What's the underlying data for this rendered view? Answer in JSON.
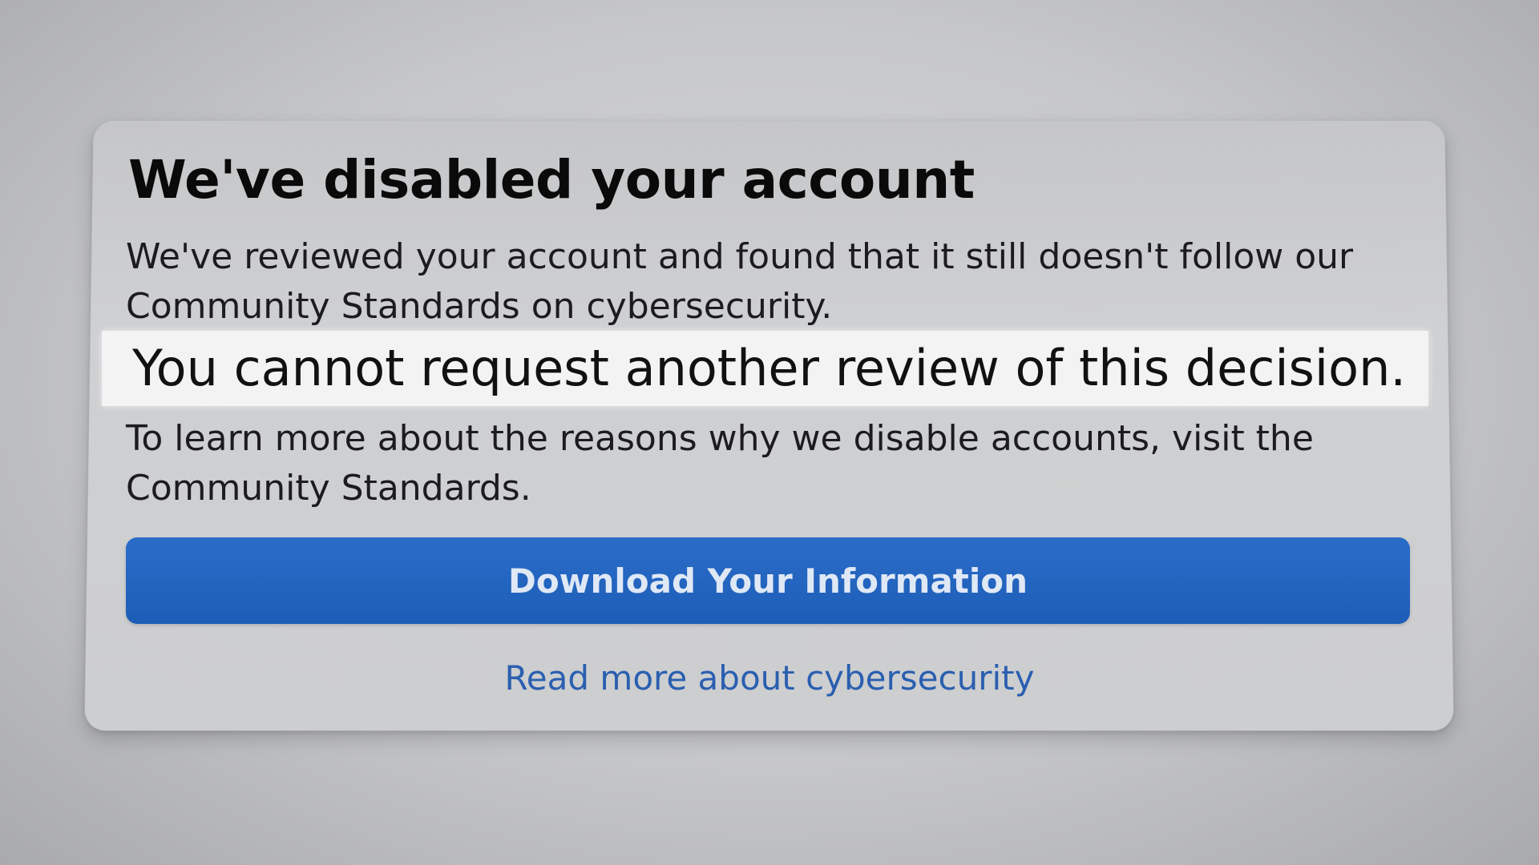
{
  "dialog": {
    "title": "We've disabled your account",
    "body_line_1": "We've reviewed your account and found that it still doesn't follow our Community Standards on cybersecurity.",
    "highlight": "You cannot request another review of this decision.",
    "body_line_2": "To learn more about the reasons why we disable accounts, visit the Community Standards.",
    "primary_button_label": "Download Your Information",
    "link_label": "Read more about cybersecurity"
  },
  "colors": {
    "button": "#1d5db7",
    "link": "#2a5fb0",
    "highlight_bg": "#f3f3f4"
  }
}
